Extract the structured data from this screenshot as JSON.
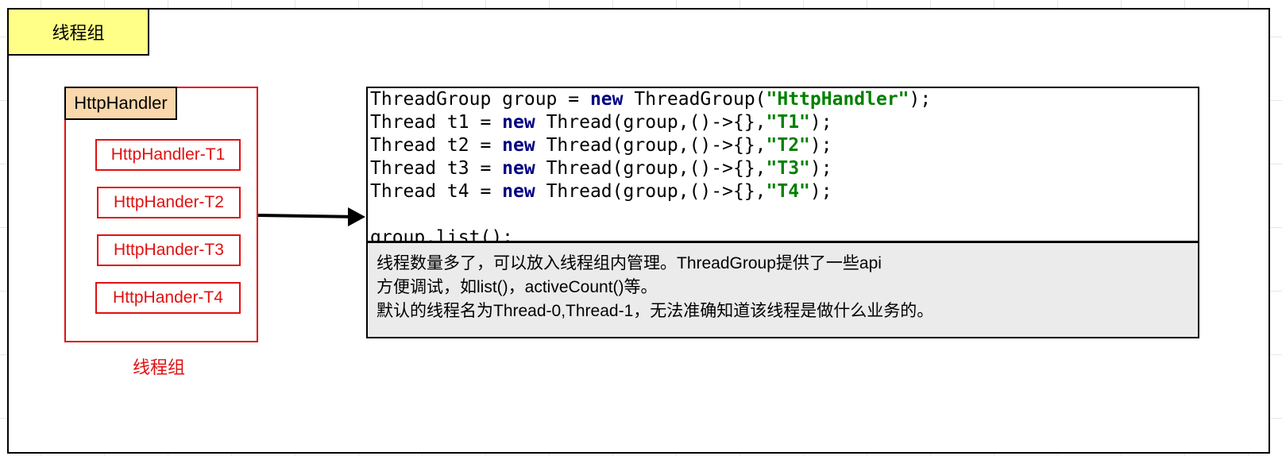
{
  "title_tag": {
    "label": "线程组"
  },
  "group": {
    "header": "HttpHandler",
    "threads": [
      "HttpHandler-T1",
      "HttpHander-T2",
      "HttpHander-T3",
      "HttpHander-T4"
    ],
    "caption": "线程组"
  },
  "code": {
    "lines": [
      [
        {
          "t": "ThreadGroup group = "
        },
        {
          "t": "new",
          "c": "kw"
        },
        {
          "t": " ThreadGroup("
        },
        {
          "t": "\"HttpHandler\"",
          "c": "str"
        },
        {
          "t": ");"
        }
      ],
      [
        {
          "t": "Thread t1 = "
        },
        {
          "t": "new",
          "c": "kw"
        },
        {
          "t": " Thread(group,()->{},"
        },
        {
          "t": "\"T1\"",
          "c": "str"
        },
        {
          "t": ");"
        }
      ],
      [
        {
          "t": "Thread t2 = "
        },
        {
          "t": "new",
          "c": "kw"
        },
        {
          "t": " Thread(group,()->{},"
        },
        {
          "t": "\"T2\"",
          "c": "str"
        },
        {
          "t": ");"
        }
      ],
      [
        {
          "t": "Thread t3 = "
        },
        {
          "t": "new",
          "c": "kw"
        },
        {
          "t": " Thread(group,()->{},"
        },
        {
          "t": "\"T3\"",
          "c": "str"
        },
        {
          "t": ");"
        }
      ],
      [
        {
          "t": "Thread t4 = "
        },
        {
          "t": "new",
          "c": "kw"
        },
        {
          "t": " Thread(group,()->{},"
        },
        {
          "t": "\"T4\"",
          "c": "str"
        },
        {
          "t": ");"
        }
      ],
      [
        {
          "t": ""
        }
      ],
      [
        {
          "t": "group.list();"
        }
      ]
    ]
  },
  "note": {
    "lines": [
      "线程数量多了，可以放入线程组内管理。ThreadGroup提供了一些api",
      "方便调试，如list()，activeCount()等。",
      "默认的线程名为Thread-0,Thread-1，无法准确知道该线程是做什么业务的。"
    ]
  },
  "colors": {
    "accent_red": "#e01010",
    "title_fill": "#ffff88",
    "header_fill": "#fad7ac",
    "keyword": "#000080",
    "string": "#008000",
    "note_fill": "#ebebeb"
  }
}
